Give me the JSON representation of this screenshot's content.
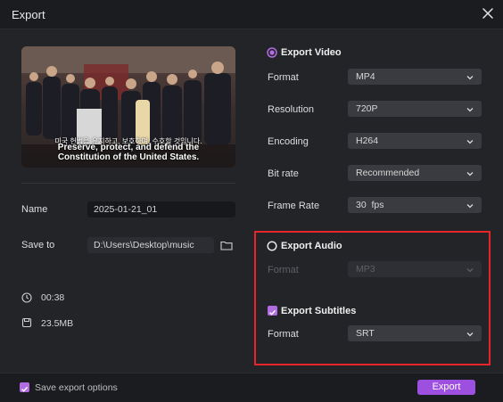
{
  "window": {
    "title": "Export"
  },
  "preview": {
    "subtitle_ko": "미국 헌법을 유지하고, 보호하며, 수호할 것입니다.",
    "subtitle_en_line1": "Preserve, protect, and defend the",
    "subtitle_en_line2": "Constitution of the United States."
  },
  "left": {
    "name_label": "Name",
    "name_value": "2025-01-21_01",
    "save_label": "Save to",
    "save_value": "D:\\Users\\Desktop\\music",
    "duration": "00:38",
    "size": "23.5MB"
  },
  "video": {
    "title": "Export Video",
    "checked": true,
    "rows": [
      {
        "label": "Format",
        "value": "MP4"
      },
      {
        "label": "Resolution",
        "value": "720P"
      },
      {
        "label": "Encoding",
        "value": "H264"
      },
      {
        "label": "Bit rate",
        "value": "Recommended"
      },
      {
        "label": "Frame Rate",
        "value": "30  fps"
      }
    ]
  },
  "audio": {
    "title": "Export Audio",
    "checked": false,
    "format_label": "Format",
    "format_value": "MP3"
  },
  "subtitles": {
    "title": "Export Subtitles",
    "checked": true,
    "format_label": "Format",
    "format_value": "SRT"
  },
  "footer": {
    "save_options_label": "Save export options",
    "export_label": "Export"
  },
  "colors": {
    "accent": "#9d4fe0",
    "highlight": "#e5252a",
    "background": "#232428"
  }
}
